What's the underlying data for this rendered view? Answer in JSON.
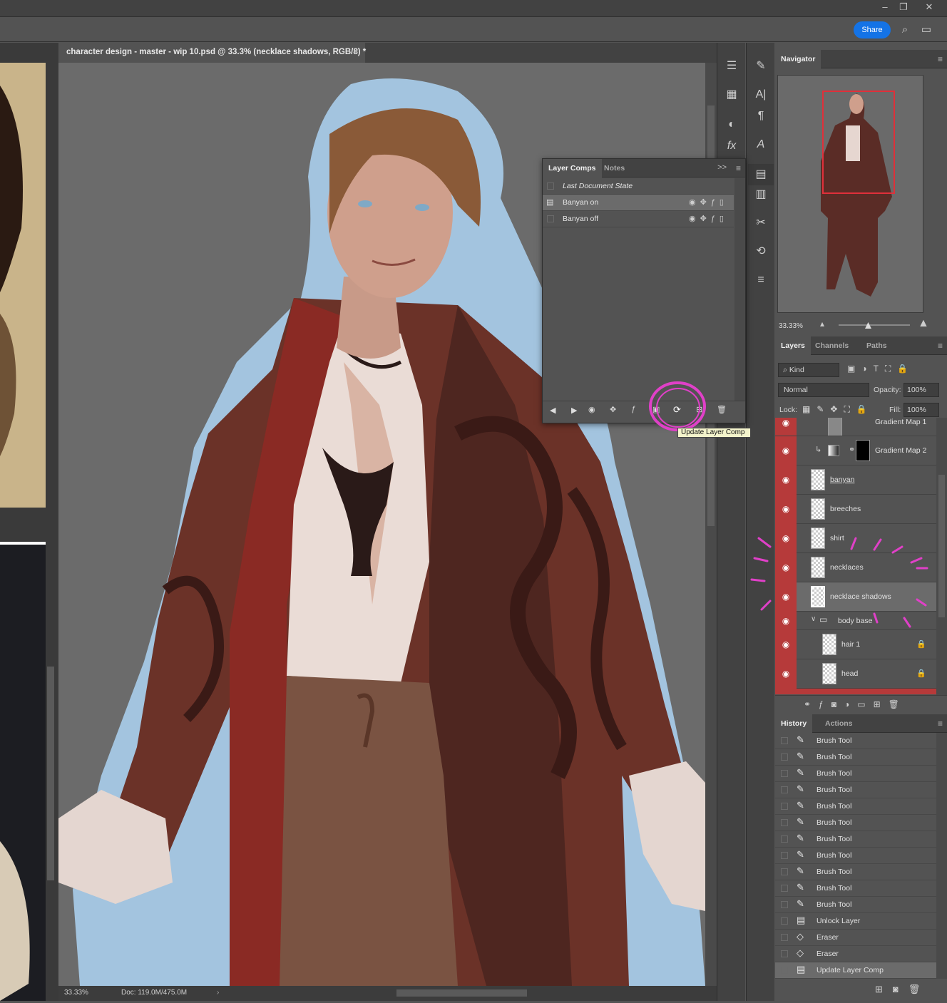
{
  "window": {
    "minimize": "–",
    "restore": "❐",
    "close": "✕"
  },
  "options_bar": {
    "share_label": "Share",
    "search_icon": "search-icon",
    "workspace_icon": "workspace-icon"
  },
  "document": {
    "tab_title": "character design - master - wip 10.psd @ 33.3% (necklace shadows, RGB/8) *",
    "tab_close": "×",
    "zoom": "33.33%",
    "doc_info": "Doc: 119.0M/475.0M"
  },
  "layer_comps": {
    "tabs": [
      "Layer Comps",
      "Notes"
    ],
    "expand": ">>",
    "rows": [
      {
        "name": "Last Document State",
        "italic": true
      },
      {
        "name": "Banyan on",
        "selected": true
      },
      {
        "name": "Banyan off"
      }
    ],
    "tooltip": "Update Layer Comp"
  },
  "navigator": {
    "tab": "Navigator",
    "zoom": "33.33%"
  },
  "layers_panel": {
    "tabs": [
      "Layers",
      "Channels",
      "Paths"
    ],
    "kind_label": "Kind",
    "blend_mode": "Normal",
    "opacity_label": "Opacity:",
    "opacity_value": "100%",
    "lock_label": "Lock:",
    "fill_label": "Fill:",
    "fill_value": "100%",
    "layers": [
      {
        "name": "Gradient Map 1"
      },
      {
        "name": "Gradient Map 2"
      },
      {
        "name": "banyan"
      },
      {
        "name": "breeches"
      },
      {
        "name": "shirt"
      },
      {
        "name": "necklaces"
      },
      {
        "name": "necklace shadows",
        "selected": true
      },
      {
        "name": "body base",
        "group": true
      },
      {
        "name": "hair 1",
        "locked": true
      },
      {
        "name": "head",
        "locked": true
      }
    ]
  },
  "history_panel": {
    "tabs": [
      "History",
      "Actions"
    ],
    "items": [
      "Brush Tool",
      "Brush Tool",
      "Brush Tool",
      "Brush Tool",
      "Brush Tool",
      "Brush Tool",
      "Brush Tool",
      "Brush Tool",
      "Brush Tool",
      "Brush Tool",
      "Brush Tool",
      "Unlock Layer",
      "Eraser",
      "Eraser",
      "Update Layer Comp"
    ]
  },
  "colors": {
    "accent": "#1473e6",
    "eye_column": "#b63a3a",
    "highlight": "#e040c8",
    "nav_rect": "#e0303a"
  }
}
